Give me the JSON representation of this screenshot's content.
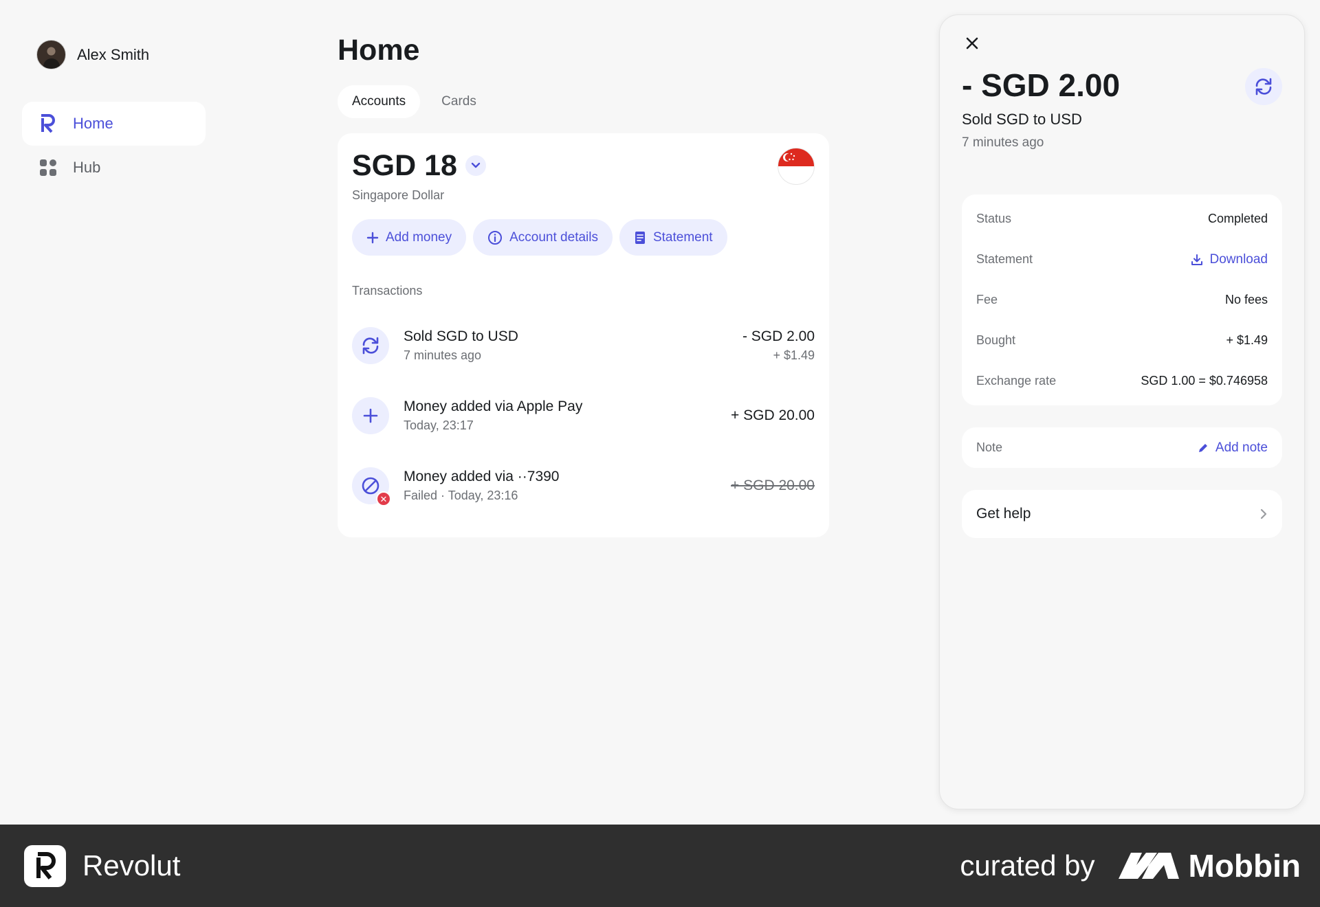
{
  "sidebar": {
    "user_name": "Alex Smith",
    "items": [
      {
        "label": "Home",
        "icon": "revolut-r-icon",
        "active": true
      },
      {
        "label": "Hub",
        "icon": "grid-icon",
        "active": false
      }
    ]
  },
  "main": {
    "title": "Home",
    "tabs": [
      {
        "label": "Accounts",
        "active": true
      },
      {
        "label": "Cards",
        "active": false
      }
    ],
    "account": {
      "balance": "SGD 18",
      "currency_name": "Singapore Dollar",
      "flag": "singapore-flag-icon",
      "actions": [
        {
          "label": "Add money",
          "icon": "plus-icon"
        },
        {
          "label": "Account details",
          "icon": "info-icon"
        },
        {
          "label": "Statement",
          "icon": "document-icon"
        }
      ]
    },
    "transactions_heading": "Transactions",
    "transactions": [
      {
        "title": "Sold SGD to USD",
        "subtitle": "7 minutes ago",
        "amount": "- SGD 2.00",
        "secondary": "+ $1.49",
        "icon": "exchange-icon",
        "failed": false
      },
      {
        "title": "Money added via Apple Pay",
        "subtitle": "Today, 23:17",
        "amount": "+ SGD 20.00",
        "secondary": "",
        "icon": "plus-icon",
        "failed": false
      },
      {
        "title": "Money added via ··7390",
        "subtitle": "Failed · Today, 23:16",
        "amount": "+ SGD 20.00",
        "secondary": "",
        "icon": "blocked-icon",
        "failed": true
      }
    ]
  },
  "panel": {
    "amount": "- SGD 2.00",
    "title": "Sold SGD to USD",
    "time": "7 minutes ago",
    "details": {
      "status_label": "Status",
      "status_value": "Completed",
      "statement_label": "Statement",
      "statement_link": "Download",
      "fee_label": "Fee",
      "fee_value": "No fees",
      "bought_label": "Bought",
      "bought_value": "+ $1.49",
      "rate_label": "Exchange rate",
      "rate_value": "SGD 1.00 = $0.746958"
    },
    "note_label": "Note",
    "note_link": "Add note",
    "help_label": "Get help"
  },
  "footer": {
    "brand": "Revolut",
    "curated_by": "curated by",
    "mobbin": "Mobbin"
  },
  "colors": {
    "accent": "#4b4fd9",
    "accent_bg": "#eceefe",
    "background": "#f7f7f7",
    "footer": "#2f2f2f",
    "failed": "#e23b4a"
  }
}
